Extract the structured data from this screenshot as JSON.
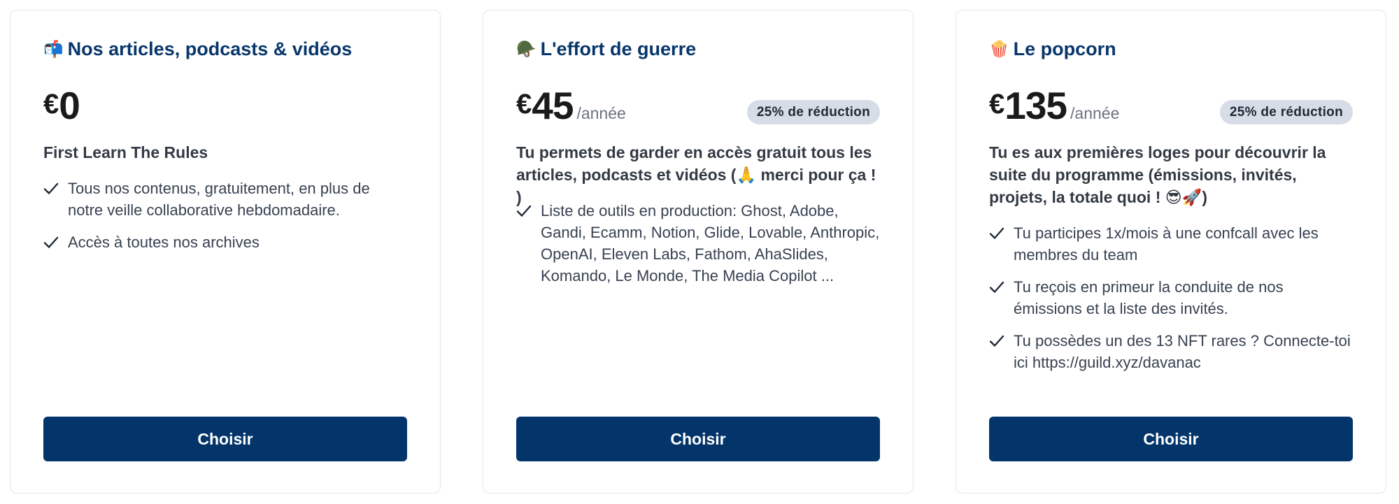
{
  "plans": [
    {
      "icon": "mailbox-icon",
      "emoji": "📬",
      "title": "Nos articles, podcasts & vidéos",
      "currency": "€",
      "amount": "0",
      "period": "",
      "badge": "",
      "subtitle": "First Learn The Rules",
      "features": [
        "Tous nos contenus, gratuitement, en plus de notre veille collaborative hebdomadaire.",
        "Accès à toutes nos archives"
      ],
      "button_label": "Choisir"
    },
    {
      "icon": "military-helmet-icon",
      "emoji": "🪖",
      "title": "L'effort de guerre",
      "currency": "€",
      "amount": "45",
      "period": "/année",
      "badge": "25% de réduction",
      "subtitle": "Tu permets de garder en accès gratuit tous les articles, podcasts et vidéos (🙏 merci pour ça ! )",
      "features": [
        "Liste de outils en production: Ghost, Adobe, Gandi, Ecamm, Notion, Glide, Lovable, Anthropic, OpenAI, Eleven Labs, Fathom, AhaSlides, Komando, Le Monde, The Media Copilot ..."
      ],
      "button_label": "Choisir"
    },
    {
      "icon": "popcorn-icon",
      "emoji": "🍿",
      "title": "Le popcorn",
      "currency": "€",
      "amount": "135",
      "period": "/année",
      "badge": "25% de réduction",
      "subtitle": "Tu es aux premières loges pour découvrir la suite du programme (émissions, invités, projets, la totale quoi ! 😎🚀)",
      "features": [
        "Tu participes 1x/mois à une confcall avec les membres du team",
        "Tu reçois en primeur la conduite de nos émissions et la liste des invités.",
        "Tu possèdes un des 13 NFT rares ? Connecte-toi ici https://guild.xyz/davanac"
      ],
      "button_label": "Choisir"
    }
  ],
  "colors": {
    "title": "#08366b",
    "button_bg": "#03356b",
    "badge_bg": "#d7dde6",
    "card_border": "#e3e6ea"
  }
}
